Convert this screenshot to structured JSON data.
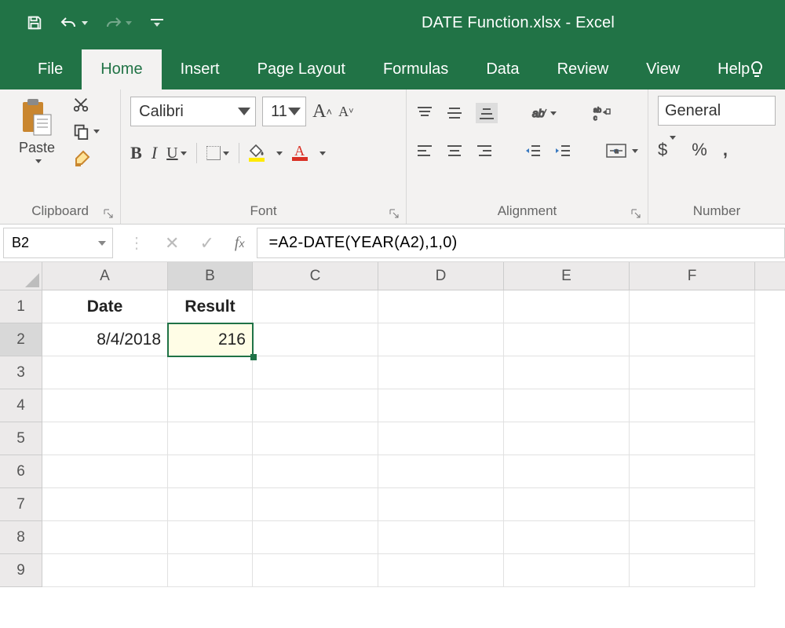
{
  "title": "DATE Function.xlsx  -  Excel",
  "menu": {
    "tabs": [
      "File",
      "Home",
      "Insert",
      "Page Layout",
      "Formulas",
      "Data",
      "Review",
      "View",
      "Help"
    ],
    "active": "Home"
  },
  "ribbon": {
    "clipboard": {
      "paste": "Paste",
      "label": "Clipboard"
    },
    "font": {
      "name": "Calibri",
      "size": "11",
      "label": "Font"
    },
    "alignment": {
      "label": "Alignment"
    },
    "number": {
      "format": "General",
      "label": "Number",
      "dollar": "$",
      "percent": "%",
      "comma": ","
    }
  },
  "formula_bar": {
    "name_box": "B2",
    "formula": "=A2-DATE(YEAR(A2),1,0)"
  },
  "grid": {
    "columns": [
      "A",
      "B",
      "C",
      "D",
      "E",
      "F"
    ],
    "rows": [
      "1",
      "2",
      "3",
      "4",
      "5",
      "6",
      "7",
      "8",
      "9"
    ],
    "selected_row": "2",
    "selected_col": "B",
    "data": {
      "A1": "Date",
      "B1": "Result",
      "A2": "8/4/2018",
      "B2": "216"
    }
  }
}
